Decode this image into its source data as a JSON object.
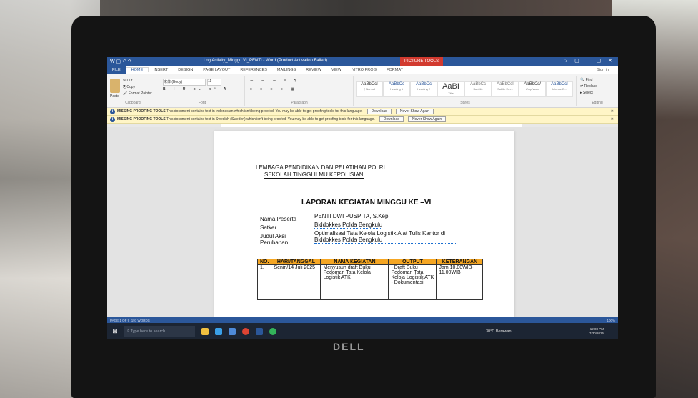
{
  "window": {
    "title": "Log Activity_Minggu VI_PENTI - Word (Product Activation Failed)",
    "picture_tools": "PICTURE TOOLS",
    "controls": "? ▢ – ▢ ✕"
  },
  "ribbon_tabs": [
    "FILE",
    "HOME",
    "INSERT",
    "DESIGN",
    "PAGE LAYOUT",
    "REFERENCES",
    "MAILINGS",
    "REVIEW",
    "VIEW",
    "NITRO PRO 9",
    "FORMAT"
  ],
  "sign_in": "Sign in",
  "clipboard": {
    "cut": "Cut",
    "copy": "Copy",
    "paste": "Paste",
    "format_painter": "Format Painter",
    "label": "Clipboard"
  },
  "font": {
    "name": "宋体 (Body)",
    "size": "11",
    "label": "Font"
  },
  "paragraph_label": "Paragraph",
  "styles": {
    "label": "Styles",
    "items": [
      {
        "sample": "AaBbCcI",
        "name": "¶ Normal"
      },
      {
        "sample": "AaBbCc",
        "name": "Heading 1"
      },
      {
        "sample": "AaBbCc",
        "name": "Heading 2"
      },
      {
        "sample": "AaBI",
        "name": "Title"
      },
      {
        "sample": "AaBbCc",
        "name": "Subtitle"
      },
      {
        "sample": "AaBbCcI",
        "name": "Subtle Em..."
      },
      {
        "sample": "AaBbCcI",
        "name": "Emphasis"
      },
      {
        "sample": "AaBbCcI",
        "name": "Intense E..."
      }
    ]
  },
  "editing": {
    "find": "Find",
    "replace": "Replace",
    "select": "Select",
    "label": "Editing"
  },
  "messages": [
    {
      "title": "MISSING PROOFING TOOLS",
      "text": "This document contains text in Indonesian which isn't being proofed. You may be able to get proofing tools for this language.",
      "download": "Download",
      "never": "Never Show Again"
    },
    {
      "title": "MISSING PROOFING TOOLS",
      "text": "This document contains text in Swedish (Sweden) which isn't being proofed. You may be able to get proofing tools for this language.",
      "download": "Download",
      "never": "Never Show Again"
    }
  ],
  "document": {
    "institution_line1": "LEMBAGA PENDIDIKAN DAN PELATIHAN POLRI",
    "institution_line2": "SEKOLAH TINGGI ILMU KEPOLISIAN",
    "heading": "LAPORAN KEGIATAN MINGGU KE –VI",
    "fields": [
      {
        "label": "Nama Peserta",
        "value": "PENTI DWI PUSPITA, S.Kep"
      },
      {
        "label": "Satker",
        "value": "Biddokkes Polda Bengkulu"
      },
      {
        "label": "Judul Aksi Perubahan",
        "value": "Optimalisasi Tata Kelola Logistik Alat Tulis Kantor di Biddokkes Polda Bengkulu"
      }
    ],
    "table": {
      "headers": [
        "NO.",
        "HARI/TANGGAL",
        "NAMA KEGIATAN",
        "OUTPUT",
        "KETERANGAN"
      ],
      "row": {
        "no": "1.",
        "date": "Senin/14 Juli 2025",
        "activity": "Menyusun draft Buku Pedoman Tata Kelola Logistik ATK",
        "output": "- Draft Buku Pedoman Tata Kelola Logistik ATK - Dokumentasi",
        "note": "Jam 10.00WIB-11.00WIB"
      }
    }
  },
  "status_bar": {
    "page": "PAGE 1 OF 9",
    "words": "197 WORDS",
    "zoom": "100%"
  },
  "taskbar": {
    "search_placeholder": "Type here to search",
    "weather": "30°C Berawan",
    "time": "12:08 PM",
    "date": "7/30/2025"
  },
  "brand": "DELL"
}
